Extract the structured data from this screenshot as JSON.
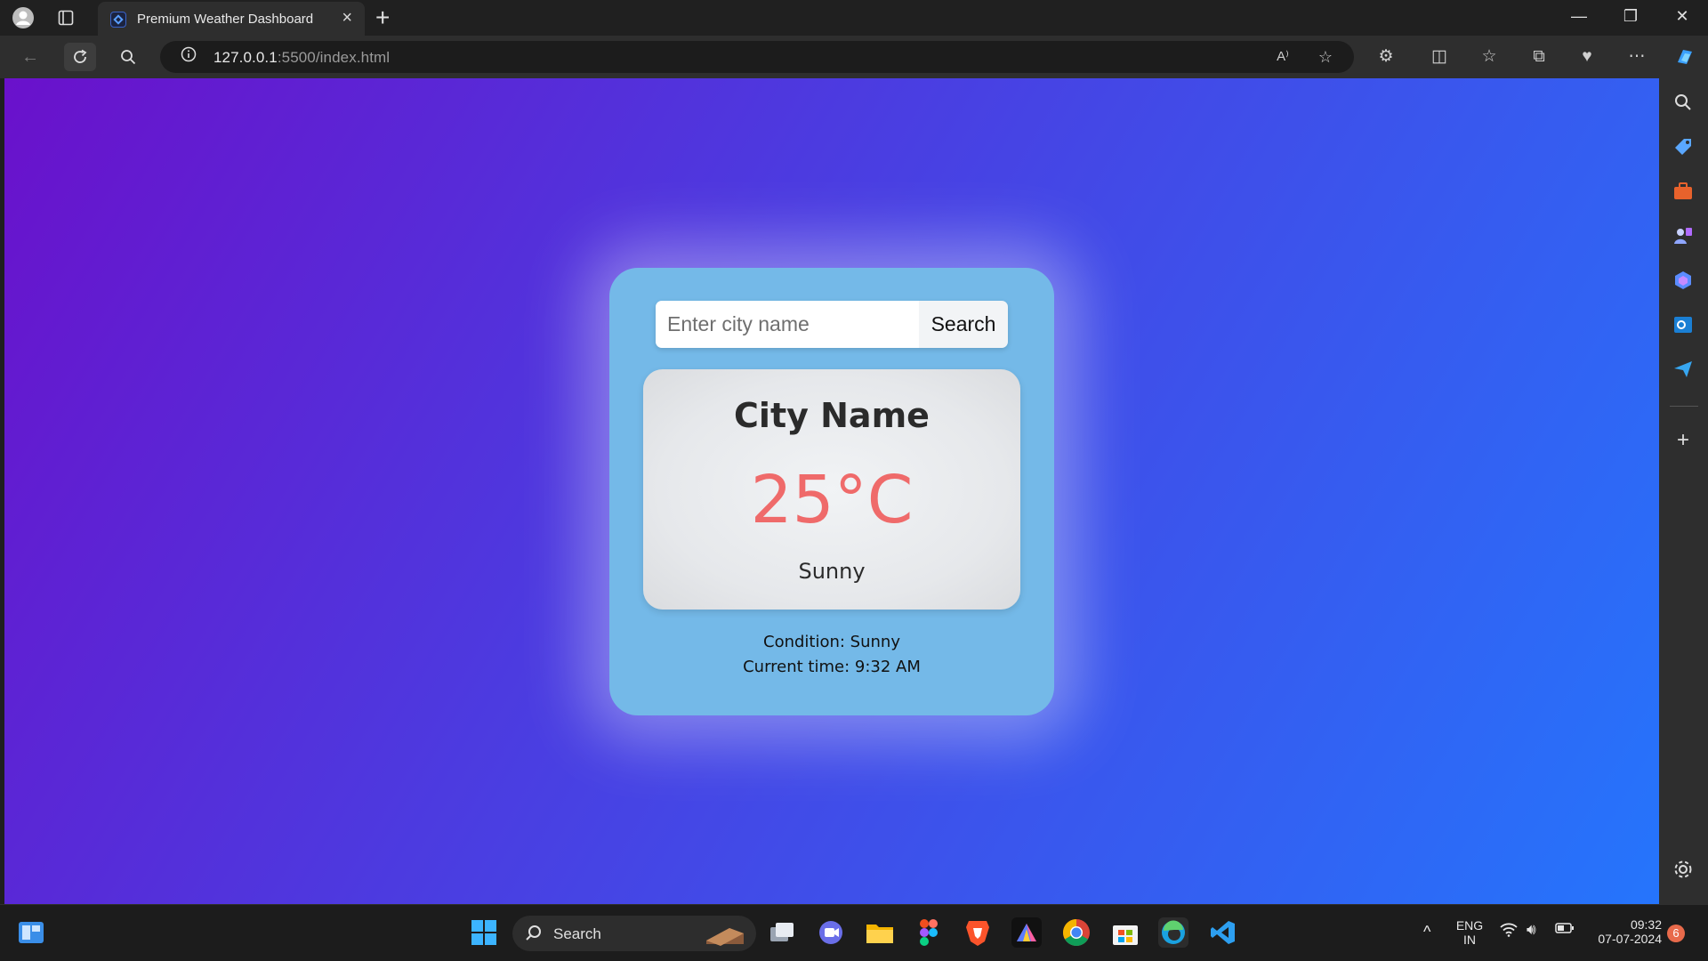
{
  "browser": {
    "tab_title": "Premium Weather Dashboard",
    "url_host": "127.0.0.1",
    "url_path": ":5500/index.html",
    "read_aloud_label": "A⁾"
  },
  "app": {
    "search_placeholder": "Enter city name",
    "search_button": "Search",
    "city_name": "City Name",
    "temperature": "25°C",
    "condition": "Sunny",
    "condition_line": "Condition: Sunny",
    "time_line": "Current time: 9:32 AM"
  },
  "taskbar": {
    "search_label": "Search",
    "language": "ENG",
    "region": "IN",
    "time": "09:32",
    "date": "07-07-2024",
    "notification_count": "6"
  },
  "colors": {
    "gradient_start": "#6a11cb",
    "gradient_end": "#2575fc",
    "card": "#74b9e8",
    "temperature": "#ef6a6a"
  }
}
